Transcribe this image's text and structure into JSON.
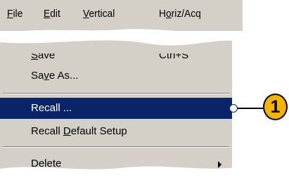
{
  "menubar": {
    "items": [
      {
        "pre": "",
        "ul": "F",
        "post": "ile"
      },
      {
        "pre": "",
        "ul": "E",
        "post": "dit"
      },
      {
        "pre": "",
        "ul": "V",
        "post": "ertical"
      },
      {
        "pre": "H",
        "ul": "o",
        "post": "riz/Acq"
      }
    ]
  },
  "menu": {
    "save": {
      "pre": "",
      "ul": "S",
      "post": "ave",
      "shortcut": "Ctrl+S"
    },
    "save_as": {
      "pre": "Sa",
      "ul": "v",
      "post": "e As..."
    },
    "recall": {
      "label": "Recall ..."
    },
    "recall_default": {
      "pre": "Recall ",
      "ul": "D",
      "post": "efault Setup"
    },
    "delete": {
      "label": "Delete"
    }
  },
  "callout": {
    "number": "1"
  },
  "colors": {
    "menu_bg": "#d4d0c8",
    "highlight": "#0a246a",
    "callout": "#f5b400"
  }
}
